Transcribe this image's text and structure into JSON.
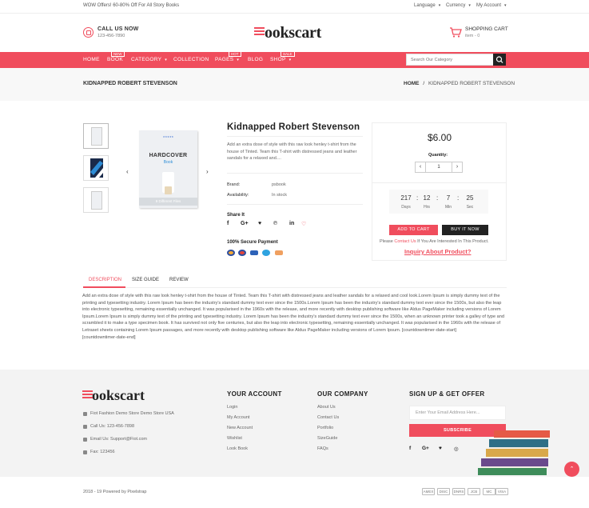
{
  "topbar": {
    "promo": "WOW Offers! 60-80% Off For All Story Books",
    "language": "Language",
    "currency": "Currency",
    "account": "My Account"
  },
  "header": {
    "call_title": "CALL US NOW",
    "call_number": "123-456-7890",
    "logo": "ookscart",
    "logo_letter": "B",
    "cart_title": "SHOPPING CART",
    "cart_sub": "item - 0"
  },
  "nav": {
    "items": [
      "HOME",
      "BOOK",
      "CATEGORY",
      "COLLECTION",
      "PAGES",
      "BLOG",
      "SHOP"
    ],
    "badges": {
      "book": "NEW",
      "pages": "HOT",
      "shop": "SALE"
    },
    "search_placeholder": "Search Our Category",
    "accent": "#f04d5d"
  },
  "breadcrumb": {
    "title": "KIDNAPPED ROBERT STEVENSON",
    "home": "HOME",
    "separator": "/",
    "current": "KIDNAPPED ROBERT STEVENSON"
  },
  "product": {
    "image_title": "HARDCOVER",
    "image_sub": "Book",
    "image_footer": "9 Different Files",
    "name": "Kidnapped Robert Stevenson",
    "description": "Add an extra dose of style with this raw look henley t-shirt from the house of Tinted. Team this T-shirt with distressed jeans and leather sandals for a relaxed and....",
    "brand_label": "Brand:",
    "brand_value": "psbook",
    "availability_label": "Availability:",
    "availability_value": "In stock",
    "share_title": "Share It",
    "secure_title": "100% Secure Payment"
  },
  "buybox": {
    "price": "$6.00",
    "quantity_label": "Quantity:",
    "quantity": "1",
    "timer": [
      {
        "value": "217",
        "label": "Days"
      },
      {
        "value": "12",
        "label": "Hrs"
      },
      {
        "value": "7",
        "label": "Min"
      },
      {
        "value": "25",
        "label": "Sec"
      }
    ],
    "add_to_cart": "ADD TO CART",
    "buy_now": "BUY IT NOW",
    "contact_pre": "Please",
    "contact_link": "Contact Us",
    "contact_post": "If You Are Interested In This Product.",
    "inquiry": "Inquiry About Product?"
  },
  "tabs": {
    "items": [
      "DESCRIPTION",
      "SIZE GUIDE",
      "REVIEW"
    ],
    "description": "Add an extra dose of style with this raw look henley t-shirt from the house of Tinted. Team this T-shirt with distressed jeans and leather sandals for a relaxed and cool look.Lorem Ipsum is simply dummy text of the printing and typesetting industry. Lorem Ipsum has been the industry's standard dummy text ever since the 1500s.Lorem Ipsum has been the industry's standard dummy text ever since the 1500s, but also the leap into electronic typesetting, remaining essentially unchanged. It was popularised in the 1960s with the release, and more recently with desktop publishing software like Aldus PageMaker including versions of Lorem Ipsum.Lorem Ipsum is simply dummy text of the printing and typesetting industry. Lorem Ipsum has been the industry's standard dummy text ever since the 1500s, when an unknown printer took a galley of type and scrambled it to make a type specimen book. It has survived not only five centuries, but also the leap into electronic typesetting, remaining essentially unchanged. It was popularised in the 1960s with the release of Letraset sheets containing Lorem Ipsum passages, and more recently with desktop publishing software like Aldus PageMaker including versions of Lorem Ipsum. [countdowntimer-date-start]",
    "description_end": "[countdowntimer-date-end]"
  },
  "footer": {
    "logo": "ookscart",
    "logo_letter": "B",
    "address": "Fiot Fashion Demo Store Demo Store USA",
    "phone": "Call Us: 123-456-7898",
    "email": "Email Us: Support@Fiot.com",
    "fax": "Fax: 123456",
    "account_title": "YOUR ACCOUNT",
    "account_links": [
      "Login",
      "My Account",
      "New Account",
      "Wishlist",
      "Look Book"
    ],
    "company_title": "OUR COMPANY",
    "company_links": [
      "About Us",
      "Contact Us",
      "Portfolio",
      "SizeGuide",
      "FAQs"
    ],
    "signup_title": "SIGN UP & GET OFFER",
    "email_placeholder": "Enter Your Email Address Here...",
    "subscribe": "SUBSCRIBE",
    "copyright": "2018 - 19 Powered by Pixelstrap",
    "payments": [
      "AMEX",
      "DISC",
      "DNRS",
      "JCB",
      "MC",
      "VISA"
    ]
  }
}
